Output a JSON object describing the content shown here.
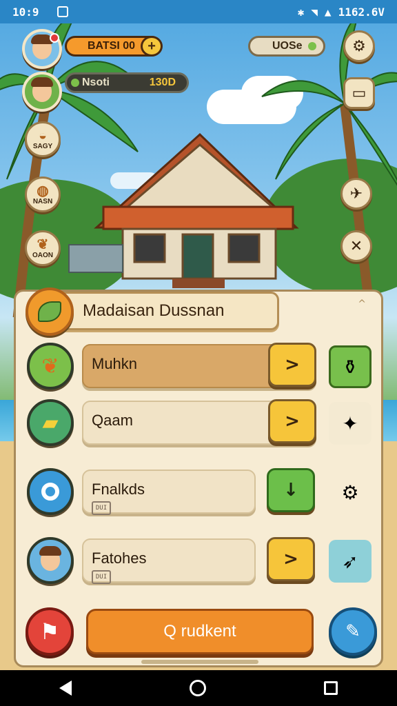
{
  "status_bar": {
    "time": "10:9",
    "right_text": "1162.6V"
  },
  "hud": {
    "coin_label": "BATSI 00",
    "energy_label": "Nsoti",
    "energy_value": "130D",
    "gem_label": "UOSe"
  },
  "side_menu": [
    {
      "label": "SAGY"
    },
    {
      "label": "NASN"
    },
    {
      "label": "OAON"
    }
  ],
  "panel": {
    "title": "Madaisan Dussnan",
    "close_symbol": "^",
    "rows": [
      {
        "label": "Muhkn",
        "sub": "",
        "button_symbol": ">",
        "button_color": "yellow",
        "selected": true
      },
      {
        "label": "Qaam",
        "sub": "",
        "button_symbol": ">",
        "button_color": "yellow",
        "selected": false
      },
      {
        "label": "Fnalkds",
        "sub": "DUI",
        "button_symbol": "↓",
        "button_color": "green",
        "selected": false
      },
      {
        "label": "Fatohes",
        "sub": "DUI",
        "button_symbol": ">",
        "button_color": "yellow",
        "selected": false
      }
    ],
    "main_button_label": "Q rudkent"
  },
  "colors": {
    "accent_orange": "#f08e2a",
    "accent_yellow": "#f6c53a",
    "accent_green": "#6cbf4a",
    "panel_bg": "#f7ecd4"
  }
}
